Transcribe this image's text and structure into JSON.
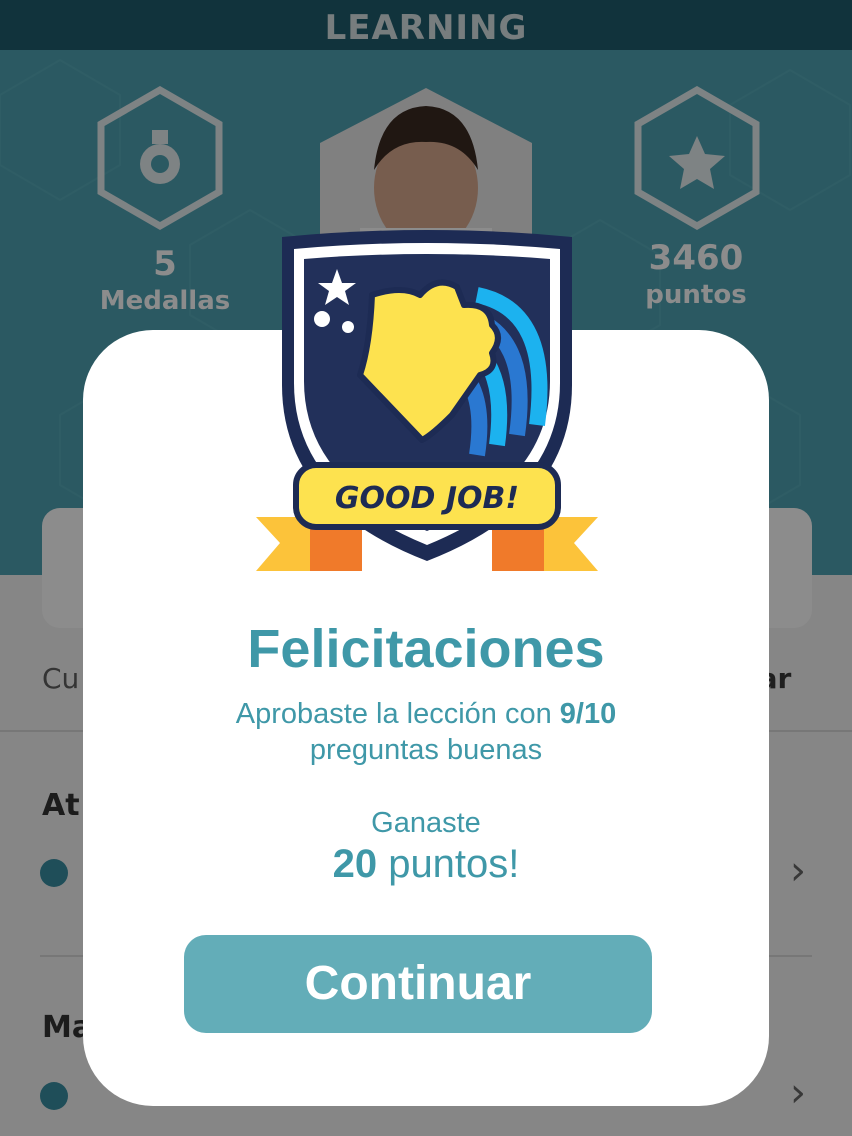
{
  "header": {
    "title": "LEARNING"
  },
  "stats": {
    "medals": {
      "icon": "medal-icon",
      "count": "5",
      "label": "Medallas"
    },
    "points": {
      "icon": "star-icon",
      "count": "3460",
      "label": "puntos"
    }
  },
  "tabs": {
    "left_partial": "Cu",
    "right_partial": "car"
  },
  "lessons": [
    {
      "title_partial": "At"
    },
    {
      "title_partial": "Ma"
    }
  ],
  "badge": {
    "banner_text": "GOOD JOB!",
    "icon": "thumbs-up-icon"
  },
  "modal": {
    "title": "Felicitaciones",
    "line1_prefix": "Aprobaste la lección con ",
    "score": "9/10",
    "line2": "preguntas buenas",
    "earned_label": "Ganaste",
    "points_value": "20",
    "points_suffix": " puntos!",
    "continue_label": "Continuar"
  },
  "colors": {
    "header": "#1f5e6e",
    "hero": "#4fa3b3",
    "accent_text": "#3f98a8",
    "button": "#63adb8"
  }
}
